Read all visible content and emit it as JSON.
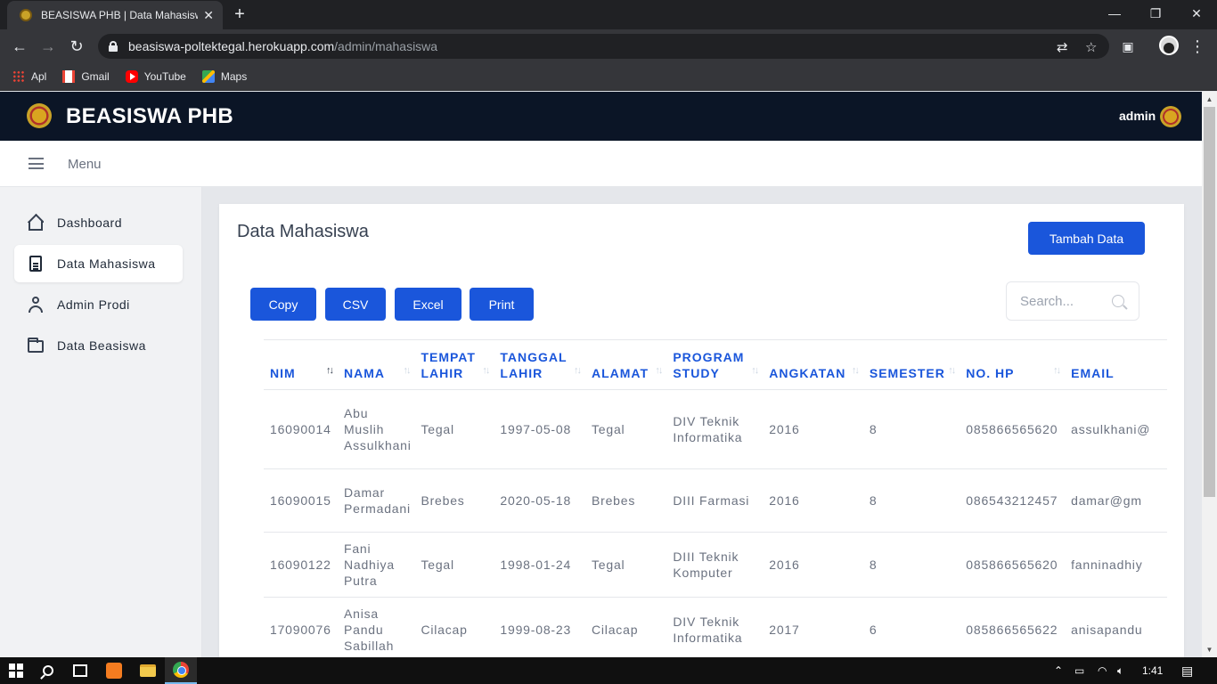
{
  "browser": {
    "tab_title": "BEASISWA PHB | Data Mahasiswa",
    "tab_close": "✕",
    "new_tab": "+",
    "url_host": "beasiswa-poltektegal.herokuapp.com",
    "url_path": "/admin/mahasiswa",
    "bookmarks": [
      {
        "label": "Apl",
        "icon": "apps-grid-icon"
      },
      {
        "label": "Gmail",
        "icon": "gmail-icon"
      },
      {
        "label": "YouTube",
        "icon": "youtube-icon"
      },
      {
        "label": "Maps",
        "icon": "maps-icon"
      }
    ]
  },
  "header": {
    "brand": "BEASISWA PHB",
    "user": "admin"
  },
  "menu_bar": {
    "label": "Menu"
  },
  "sidebar": {
    "items": [
      {
        "label": "Dashboard",
        "icon": "home-icon",
        "active": false
      },
      {
        "label": "Data Mahasiswa",
        "icon": "document-icon",
        "active": true
      },
      {
        "label": "Admin Prodi",
        "icon": "user-icon",
        "active": false
      },
      {
        "label": "Data Beasiswa",
        "icon": "folder-icon",
        "active": false
      }
    ]
  },
  "main": {
    "title": "Data Mahasiswa",
    "add_button": "Tambah Data",
    "export_buttons": [
      "Copy",
      "CSV",
      "Excel",
      "Print"
    ],
    "search_placeholder": "Search...",
    "columns": [
      "NIM",
      "NAMA",
      "TEMPAT LAHIR",
      "TANGGAL LAHIR",
      "ALAMAT",
      "PROGRAM STUDY",
      "ANGKATAN",
      "SEMESTER",
      "NO. HP",
      "EMAIL"
    ],
    "rows": [
      {
        "nim": "16090014",
        "nama": "Abu Muslih Assulkhani",
        "tempat_lahir": "Tegal",
        "tanggal_lahir": "1997-05-08",
        "alamat": "Tegal",
        "program_study": "DIV Teknik Informatika",
        "angkatan": "2016",
        "semester": "8",
        "no_hp": "085866565620",
        "email": "assulkhani@"
      },
      {
        "nim": "16090015",
        "nama": "Damar Permadani",
        "tempat_lahir": "Brebes",
        "tanggal_lahir": "2020-05-18",
        "alamat": "Brebes",
        "program_study": "DIII Farmasi",
        "angkatan": "2016",
        "semester": "8",
        "no_hp": "086543212457",
        "email": "damar@gm"
      },
      {
        "nim": "16090122",
        "nama": "Fani Nadhiya Putra",
        "tempat_lahir": "Tegal",
        "tanggal_lahir": "1998-01-24",
        "alamat": "Tegal",
        "program_study": "DIII Teknik Komputer",
        "angkatan": "2016",
        "semester": "8",
        "no_hp": "085866565620",
        "email": "fanninadhiy"
      },
      {
        "nim": "17090076",
        "nama": "Anisa Pandu Sabillah",
        "tempat_lahir": "Cilacap",
        "tanggal_lahir": "1999-08-23",
        "alamat": "Cilacap",
        "program_study": "DIV Teknik Informatika",
        "angkatan": "2017",
        "semester": "6",
        "no_hp": "085866565622",
        "email": "anisapandu"
      }
    ]
  },
  "taskbar": {
    "clock": "1:41"
  },
  "colors": {
    "header_bg": "#0b1526",
    "primary": "#1a56db",
    "sidebar_bg": "#f1f2f4"
  }
}
